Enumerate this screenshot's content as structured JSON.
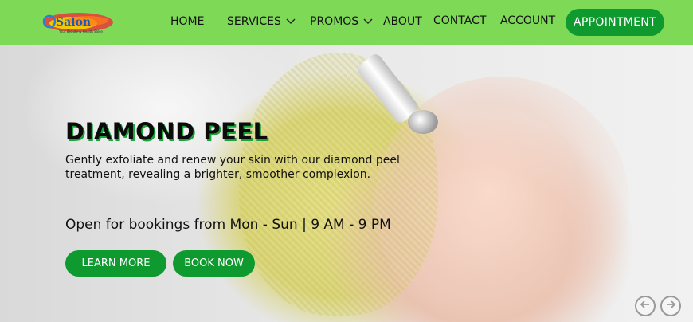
{
  "brand": {
    "logo_text": "Salon",
    "logo_tagline": "Your Beauty & Health Salon"
  },
  "nav": {
    "items": [
      {
        "label": "HOME",
        "has_dropdown": false
      },
      {
        "label": "SERVICES",
        "has_dropdown": true
      },
      {
        "label": "PROMOS",
        "has_dropdown": true
      },
      {
        "label": "ABOUT",
        "has_dropdown": false
      },
      {
        "label": "CONTACT",
        "has_dropdown": false
      },
      {
        "label": "ACCOUNT",
        "has_dropdown": false
      }
    ],
    "cta_label": "APPOINTMENT"
  },
  "hero": {
    "title": "DIAMOND PEEL",
    "description": "Gently exfoliate and renew your skin with our diamond peel treatment, revealing a brighter, smoother complexion.",
    "hours": "Open for bookings from Mon - Sun | 9 AM - 9 PM",
    "learn_more_label": "LEARN MORE",
    "book_now_label": "BOOK NOW"
  },
  "carousel": {
    "prev_icon": "arrow-left-icon",
    "next_icon": "arrow-right-icon"
  },
  "colors": {
    "nav_background": "#7ed957",
    "accent_green": "#0e9a2e",
    "title_shadow": "#19a33b"
  }
}
